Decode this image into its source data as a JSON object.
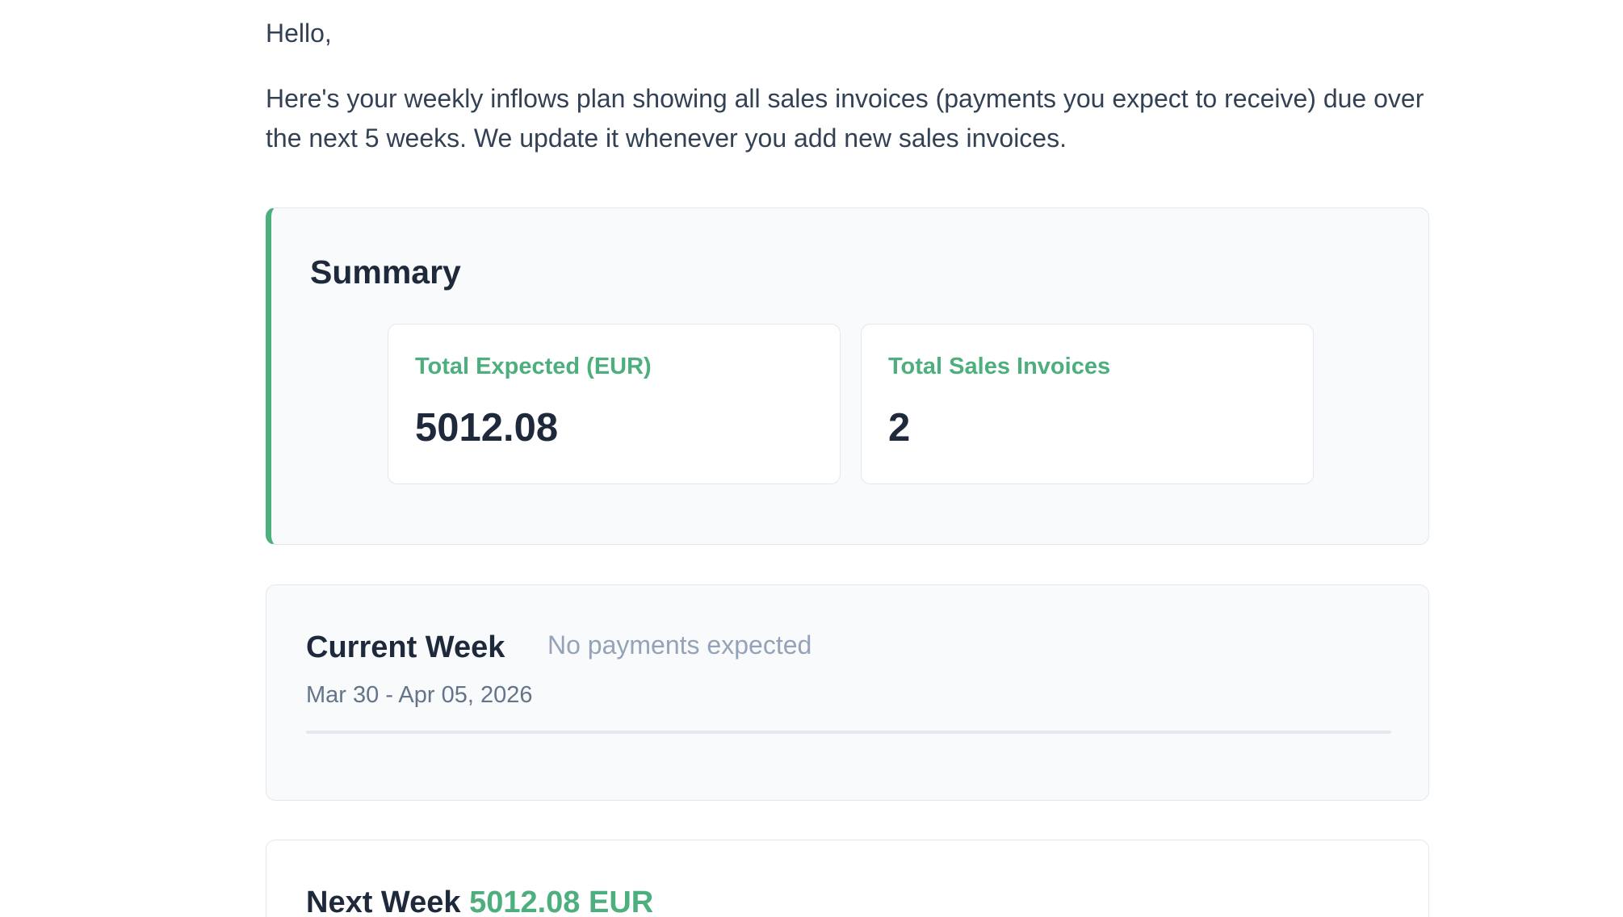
{
  "email": {
    "greeting": "Hello,",
    "intro": "Here's your weekly inflows plan showing all sales invoices (payments you expect to receive) due over the next 5 weeks. We update it whenever you add new sales invoices."
  },
  "summary": {
    "title": "Summary",
    "stats": [
      {
        "label": "Total Expected (EUR)",
        "value": "5012.08"
      },
      {
        "label": "Total Sales Invoices",
        "value": "2"
      }
    ]
  },
  "weeks": {
    "current": {
      "title": "Current Week",
      "status": "No payments expected",
      "dates": "Mar 30 - Apr 05, 2026"
    },
    "next": {
      "title": "Next Week",
      "amount": "5012.08 EUR"
    }
  },
  "colors": {
    "accent": "#4caf7d",
    "heading": "#1e293b",
    "body_text": "#334155",
    "muted": "#94a3b8",
    "card_bg": "#f8fafc",
    "border": "#e2e8f0"
  }
}
